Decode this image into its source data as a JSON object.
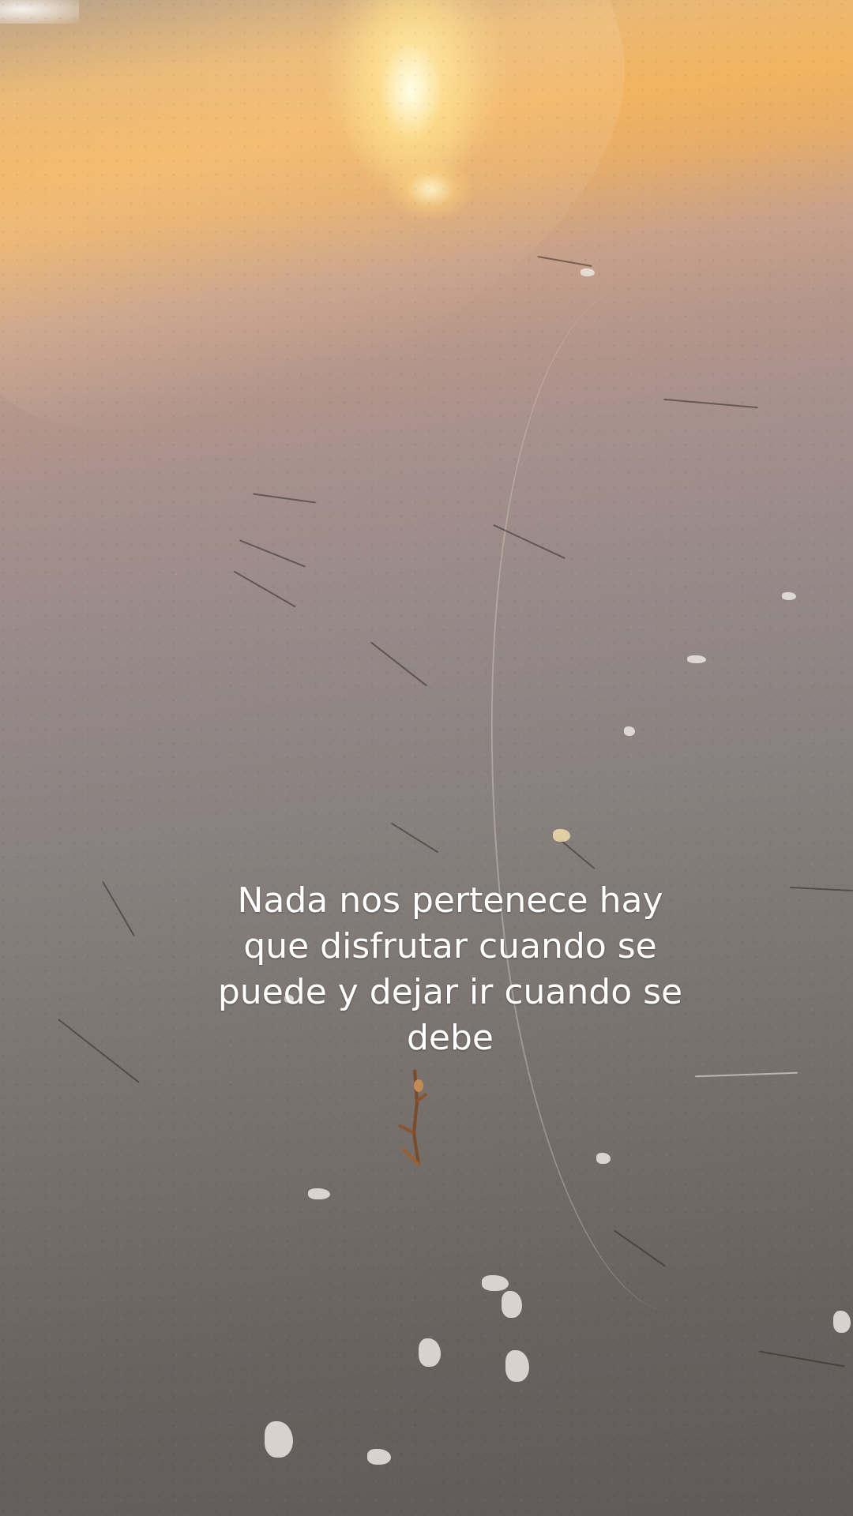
{
  "caption": {
    "lines": [
      "Nada nos pertenece hay",
      "que disfrutar cuando se",
      "puede y dejar ir cuando se",
      "debe"
    ]
  },
  "scene": {
    "description_icon": "beach-sunset-photo",
    "colors": {
      "sun": "#fff4d6",
      "sand_dark": "#5f5a58",
      "sand_light": "#a38f8c",
      "glow": "#f2b45f"
    }
  }
}
